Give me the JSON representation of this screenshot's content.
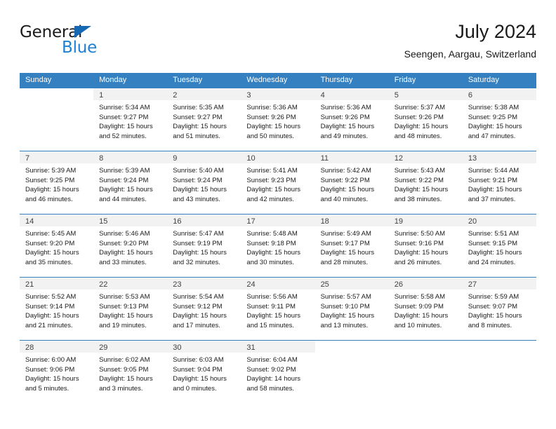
{
  "brand": {
    "name_part1": "General",
    "name_part2": "Blue",
    "triangle_color": "#1668b3",
    "blue_color": "#1f7fd1"
  },
  "header": {
    "title": "July 2024",
    "subtitle": "Seengen, Aargau, Switzerland"
  },
  "theme": {
    "header_blue": "#3580c0",
    "day_band_gray": "#f2f2f2",
    "text_color": "#1a1a1a"
  },
  "weekday_headers": [
    "Sunday",
    "Monday",
    "Tuesday",
    "Wednesday",
    "Thursday",
    "Friday",
    "Saturday"
  ],
  "weeks": [
    [
      {
        "day": "",
        "sunrise": "",
        "sunset": "",
        "daylight_line1": "",
        "daylight_line2": ""
      },
      {
        "day": "1",
        "sunrise": "Sunrise: 5:34 AM",
        "sunset": "Sunset: 9:27 PM",
        "daylight_line1": "Daylight: 15 hours",
        "daylight_line2": "and 52 minutes."
      },
      {
        "day": "2",
        "sunrise": "Sunrise: 5:35 AM",
        "sunset": "Sunset: 9:27 PM",
        "daylight_line1": "Daylight: 15 hours",
        "daylight_line2": "and 51 minutes."
      },
      {
        "day": "3",
        "sunrise": "Sunrise: 5:36 AM",
        "sunset": "Sunset: 9:26 PM",
        "daylight_line1": "Daylight: 15 hours",
        "daylight_line2": "and 50 minutes."
      },
      {
        "day": "4",
        "sunrise": "Sunrise: 5:36 AM",
        "sunset": "Sunset: 9:26 PM",
        "daylight_line1": "Daylight: 15 hours",
        "daylight_line2": "and 49 minutes."
      },
      {
        "day": "5",
        "sunrise": "Sunrise: 5:37 AM",
        "sunset": "Sunset: 9:26 PM",
        "daylight_line1": "Daylight: 15 hours",
        "daylight_line2": "and 48 minutes."
      },
      {
        "day": "6",
        "sunrise": "Sunrise: 5:38 AM",
        "sunset": "Sunset: 9:25 PM",
        "daylight_line1": "Daylight: 15 hours",
        "daylight_line2": "and 47 minutes."
      }
    ],
    [
      {
        "day": "7",
        "sunrise": "Sunrise: 5:39 AM",
        "sunset": "Sunset: 9:25 PM",
        "daylight_line1": "Daylight: 15 hours",
        "daylight_line2": "and 46 minutes."
      },
      {
        "day": "8",
        "sunrise": "Sunrise: 5:39 AM",
        "sunset": "Sunset: 9:24 PM",
        "daylight_line1": "Daylight: 15 hours",
        "daylight_line2": "and 44 minutes."
      },
      {
        "day": "9",
        "sunrise": "Sunrise: 5:40 AM",
        "sunset": "Sunset: 9:24 PM",
        "daylight_line1": "Daylight: 15 hours",
        "daylight_line2": "and 43 minutes."
      },
      {
        "day": "10",
        "sunrise": "Sunrise: 5:41 AM",
        "sunset": "Sunset: 9:23 PM",
        "daylight_line1": "Daylight: 15 hours",
        "daylight_line2": "and 42 minutes."
      },
      {
        "day": "11",
        "sunrise": "Sunrise: 5:42 AM",
        "sunset": "Sunset: 9:22 PM",
        "daylight_line1": "Daylight: 15 hours",
        "daylight_line2": "and 40 minutes."
      },
      {
        "day": "12",
        "sunrise": "Sunrise: 5:43 AM",
        "sunset": "Sunset: 9:22 PM",
        "daylight_line1": "Daylight: 15 hours",
        "daylight_line2": "and 38 minutes."
      },
      {
        "day": "13",
        "sunrise": "Sunrise: 5:44 AM",
        "sunset": "Sunset: 9:21 PM",
        "daylight_line1": "Daylight: 15 hours",
        "daylight_line2": "and 37 minutes."
      }
    ],
    [
      {
        "day": "14",
        "sunrise": "Sunrise: 5:45 AM",
        "sunset": "Sunset: 9:20 PM",
        "daylight_line1": "Daylight: 15 hours",
        "daylight_line2": "and 35 minutes."
      },
      {
        "day": "15",
        "sunrise": "Sunrise: 5:46 AM",
        "sunset": "Sunset: 9:20 PM",
        "daylight_line1": "Daylight: 15 hours",
        "daylight_line2": "and 33 minutes."
      },
      {
        "day": "16",
        "sunrise": "Sunrise: 5:47 AM",
        "sunset": "Sunset: 9:19 PM",
        "daylight_line1": "Daylight: 15 hours",
        "daylight_line2": "and 32 minutes."
      },
      {
        "day": "17",
        "sunrise": "Sunrise: 5:48 AM",
        "sunset": "Sunset: 9:18 PM",
        "daylight_line1": "Daylight: 15 hours",
        "daylight_line2": "and 30 minutes."
      },
      {
        "day": "18",
        "sunrise": "Sunrise: 5:49 AM",
        "sunset": "Sunset: 9:17 PM",
        "daylight_line1": "Daylight: 15 hours",
        "daylight_line2": "and 28 minutes."
      },
      {
        "day": "19",
        "sunrise": "Sunrise: 5:50 AM",
        "sunset": "Sunset: 9:16 PM",
        "daylight_line1": "Daylight: 15 hours",
        "daylight_line2": "and 26 minutes."
      },
      {
        "day": "20",
        "sunrise": "Sunrise: 5:51 AM",
        "sunset": "Sunset: 9:15 PM",
        "daylight_line1": "Daylight: 15 hours",
        "daylight_line2": "and 24 minutes."
      }
    ],
    [
      {
        "day": "21",
        "sunrise": "Sunrise: 5:52 AM",
        "sunset": "Sunset: 9:14 PM",
        "daylight_line1": "Daylight: 15 hours",
        "daylight_line2": "and 21 minutes."
      },
      {
        "day": "22",
        "sunrise": "Sunrise: 5:53 AM",
        "sunset": "Sunset: 9:13 PM",
        "daylight_line1": "Daylight: 15 hours",
        "daylight_line2": "and 19 minutes."
      },
      {
        "day": "23",
        "sunrise": "Sunrise: 5:54 AM",
        "sunset": "Sunset: 9:12 PM",
        "daylight_line1": "Daylight: 15 hours",
        "daylight_line2": "and 17 minutes."
      },
      {
        "day": "24",
        "sunrise": "Sunrise: 5:56 AM",
        "sunset": "Sunset: 9:11 PM",
        "daylight_line1": "Daylight: 15 hours",
        "daylight_line2": "and 15 minutes."
      },
      {
        "day": "25",
        "sunrise": "Sunrise: 5:57 AM",
        "sunset": "Sunset: 9:10 PM",
        "daylight_line1": "Daylight: 15 hours",
        "daylight_line2": "and 13 minutes."
      },
      {
        "day": "26",
        "sunrise": "Sunrise: 5:58 AM",
        "sunset": "Sunset: 9:09 PM",
        "daylight_line1": "Daylight: 15 hours",
        "daylight_line2": "and 10 minutes."
      },
      {
        "day": "27",
        "sunrise": "Sunrise: 5:59 AM",
        "sunset": "Sunset: 9:07 PM",
        "daylight_line1": "Daylight: 15 hours",
        "daylight_line2": "and 8 minutes."
      }
    ],
    [
      {
        "day": "28",
        "sunrise": "Sunrise: 6:00 AM",
        "sunset": "Sunset: 9:06 PM",
        "daylight_line1": "Daylight: 15 hours",
        "daylight_line2": "and 5 minutes."
      },
      {
        "day": "29",
        "sunrise": "Sunrise: 6:02 AM",
        "sunset": "Sunset: 9:05 PM",
        "daylight_line1": "Daylight: 15 hours",
        "daylight_line2": "and 3 minutes."
      },
      {
        "day": "30",
        "sunrise": "Sunrise: 6:03 AM",
        "sunset": "Sunset: 9:04 PM",
        "daylight_line1": "Daylight: 15 hours",
        "daylight_line2": "and 0 minutes."
      },
      {
        "day": "31",
        "sunrise": "Sunrise: 6:04 AM",
        "sunset": "Sunset: 9:02 PM",
        "daylight_line1": "Daylight: 14 hours",
        "daylight_line2": "and 58 minutes."
      },
      {
        "day": "",
        "sunrise": "",
        "sunset": "",
        "daylight_line1": "",
        "daylight_line2": ""
      },
      {
        "day": "",
        "sunrise": "",
        "sunset": "",
        "daylight_line1": "",
        "daylight_line2": ""
      },
      {
        "day": "",
        "sunrise": "",
        "sunset": "",
        "daylight_line1": "",
        "daylight_line2": ""
      }
    ]
  ]
}
